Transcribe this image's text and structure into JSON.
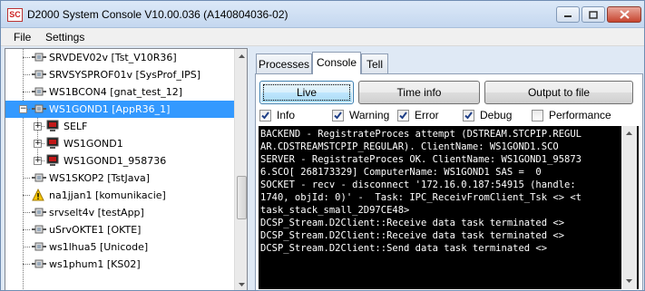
{
  "window": {
    "app_icon_text": "SC",
    "title": "D2000 System Console V10.00.036 (A140804036-02)"
  },
  "menu": {
    "items": [
      "File",
      "Settings"
    ]
  },
  "tree": {
    "items": [
      {
        "label": "SRVDEV02v [Tst_V10R36]",
        "icon": "process-icon"
      },
      {
        "label": "SRVSYSPROF01v [SysProf_IPS]",
        "icon": "process-icon"
      },
      {
        "label": "WS1BCON4 [gnat_test_12]",
        "icon": "process-icon"
      },
      {
        "label": "WS1GOND1 [AppR36_1]",
        "icon": "process-icon",
        "selected": true,
        "expanded": true
      },
      {
        "label": "SELF",
        "icon": "computer-icon",
        "child": true
      },
      {
        "label": "WS1GOND1",
        "icon": "computer-icon",
        "child": true
      },
      {
        "label": "WS1GOND1_958736",
        "icon": "computer-icon",
        "child": true
      },
      {
        "label": "WS1SKOP2 [TstJava]",
        "icon": "process-icon"
      },
      {
        "label": "na1jjan1 [komunikacie]",
        "icon": "warning-icon"
      },
      {
        "label": "srvselt4v [testApp]",
        "icon": "process-icon"
      },
      {
        "label": "uSrvOKTE1 [OKTE]",
        "icon": "process-icon"
      },
      {
        "label": "ws1lhua5 [Unicode]",
        "icon": "process-icon"
      },
      {
        "label": "ws1phum1 [KS02]",
        "icon": "process-icon"
      }
    ]
  },
  "tabs": [
    "Processes",
    "Console",
    "Tell"
  ],
  "active_tab": "Console",
  "buttons": {
    "live": "Live",
    "time_info": "Time info",
    "output_to_file": "Output to file"
  },
  "filters": [
    {
      "label": "Info",
      "checked": true
    },
    {
      "label": "Warning",
      "checked": true
    },
    {
      "label": "Error",
      "checked": true
    },
    {
      "label": "Debug",
      "checked": true
    },
    {
      "label": "Performance",
      "checked": false
    }
  ],
  "console": {
    "lines": [
      "BACKEND - RegistrateProces attempt (DSTREAM.STCPIP.REGUL",
      "AR.CDSTREAMSTCPIP_REGULAR). ClientName: WS1GOND1.SCO",
      "SERVER - RegistrateProces OK. ClientName: WS1GOND1_95873",
      "6.SCO[ 268173329] ComputerName: WS1GOND1 SAS =  0",
      "SOCKET - recv - disconnect '172.16.0.187:54915 (handle:",
      "1740, objId: 0)' -  Task: IPC_ReceivFromClient_Tsk <> <t",
      "task_stack_small_2D97CE48>",
      "DCSP_Stream.D2Client::Receive data task terminated <>",
      "DCSP_Stream.D2Client::Receive data task terminated <>",
      "DCSP_Stream.D2Client::Send data task terminated <>"
    ]
  },
  "colors": {
    "selection": "#3399ff",
    "console_bg": "#000000",
    "console_fg": "#ffffff",
    "frame": "#dfe9f5"
  }
}
